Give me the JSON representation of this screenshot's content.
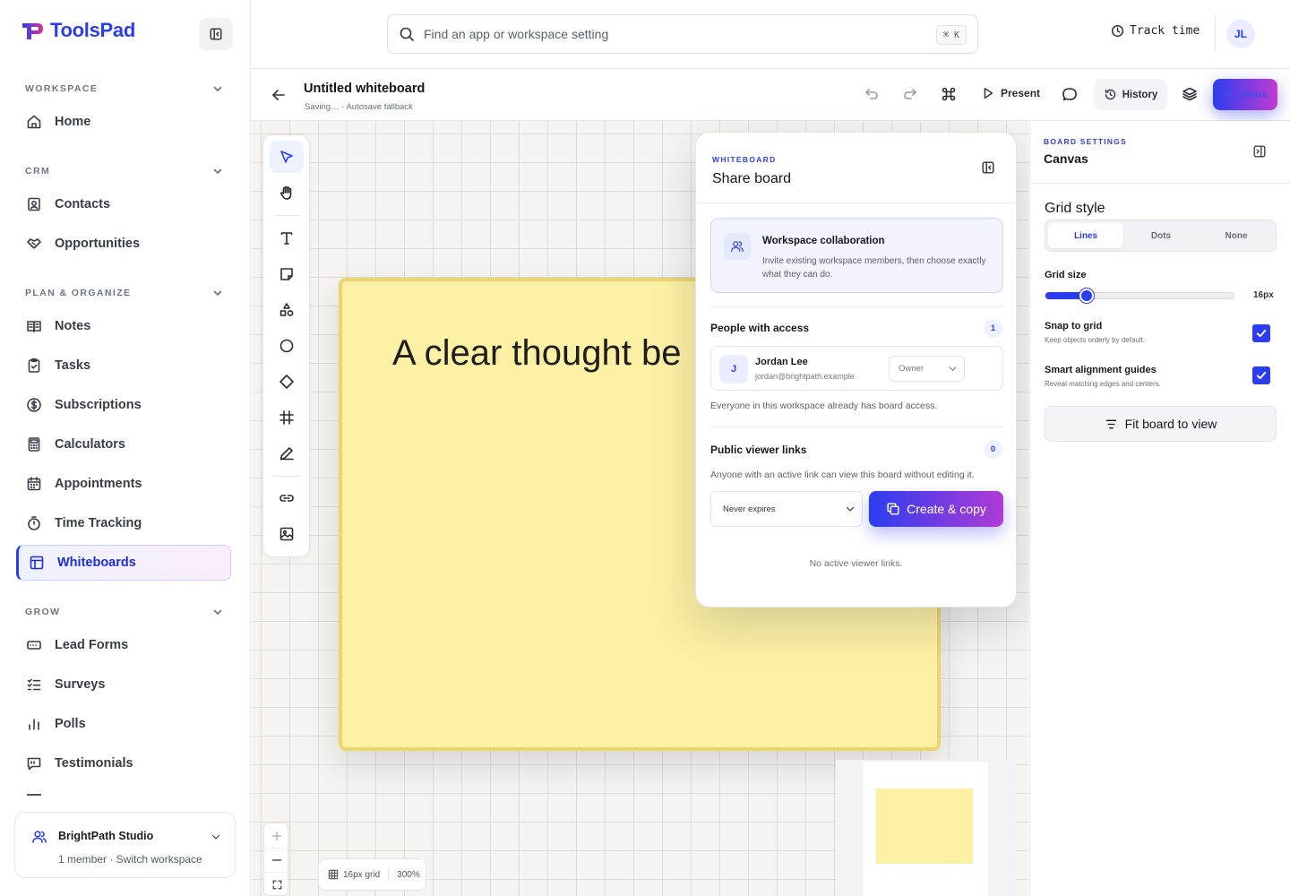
{
  "app": {
    "name": "ToolsPad",
    "brand_color": "#2c3df0",
    "accent_gradient": [
      "#2c3df0",
      "#c23bd4"
    ]
  },
  "sidebar": {
    "sections": [
      {
        "label": "WORKSPACE",
        "items": [
          {
            "label": "Home",
            "icon": "home-icon"
          }
        ]
      },
      {
        "label": "CRM",
        "items": [
          {
            "label": "Contacts",
            "icon": "contacts-icon"
          },
          {
            "label": "Opportunities",
            "icon": "handshake-icon"
          }
        ]
      },
      {
        "label": "PLAN & ORGANIZE",
        "items": [
          {
            "label": "Notes",
            "icon": "notes-icon"
          },
          {
            "label": "Tasks",
            "icon": "tasks-icon"
          },
          {
            "label": "Subscriptions",
            "icon": "dollar-icon"
          },
          {
            "label": "Calculators",
            "icon": "calculator-icon"
          },
          {
            "label": "Appointments",
            "icon": "calendar-icon"
          },
          {
            "label": "Time Tracking",
            "icon": "stopwatch-icon"
          },
          {
            "label": "Whiteboards",
            "icon": "whiteboard-icon",
            "active": true
          }
        ]
      },
      {
        "label": "GROW",
        "items": [
          {
            "label": "Lead Forms",
            "icon": "form-icon"
          },
          {
            "label": "Surveys",
            "icon": "checklist-icon"
          },
          {
            "label": "Polls",
            "icon": "bar-chart-icon"
          },
          {
            "label": "Testimonials",
            "icon": "quote-icon"
          }
        ]
      }
    ],
    "workspace": {
      "name": "BrightPath Studio",
      "subtitle": "1 member · Switch workspace"
    }
  },
  "topbar": {
    "search_placeholder": "Find an app or workspace setting",
    "shortcut": "⌘ K",
    "track_time": "Track time",
    "avatar_initials": "JL"
  },
  "board": {
    "title": "Untitled whiteboard",
    "status": "Saving… · Autosave fallback",
    "present_label": "Present",
    "history_label": "History",
    "share_label": "Share"
  },
  "canvas": {
    "sticky_text": "A clear thought be",
    "sticky_color": "#fcf0a4",
    "grid_label": "16px grid",
    "zoom": "300%"
  },
  "share_popover": {
    "kicker": "WHITEBOARD",
    "title": "Share board",
    "collab_title": "Workspace collaboration",
    "collab_desc": "Invite existing workspace members, then choose exactly what they can do.",
    "people_title": "People with access",
    "people_count": "1",
    "person": {
      "initial": "J",
      "name": "Jordan Lee",
      "email": "jordan@brightpath.example",
      "role": "Owner"
    },
    "people_note": "Everyone in this workspace already has board access.",
    "links_title": "Public viewer links",
    "links_count": "0",
    "links_note": "Anyone with an active link can view this board without editing it.",
    "expires": "Never expires",
    "create_label": "Create & copy",
    "empty_note": "No active viewer links."
  },
  "settings": {
    "kicker": "BOARD SETTINGS",
    "title": "Canvas",
    "grid_style_label": "Grid style",
    "grid_styles": [
      "Lines",
      "Dots",
      "None"
    ],
    "grid_style_selected": "Lines",
    "grid_size_label": "Grid size",
    "grid_size_value": "16px",
    "grid_size_fraction": 0.22,
    "snap_title": "Snap to grid",
    "snap_desc": "Keep objects orderly by default.",
    "snap_checked": true,
    "guides_title": "Smart alignment guides",
    "guides_desc": "Reveal matching edges and centers.",
    "guides_checked": true,
    "fit_label": "Fit board to view"
  }
}
